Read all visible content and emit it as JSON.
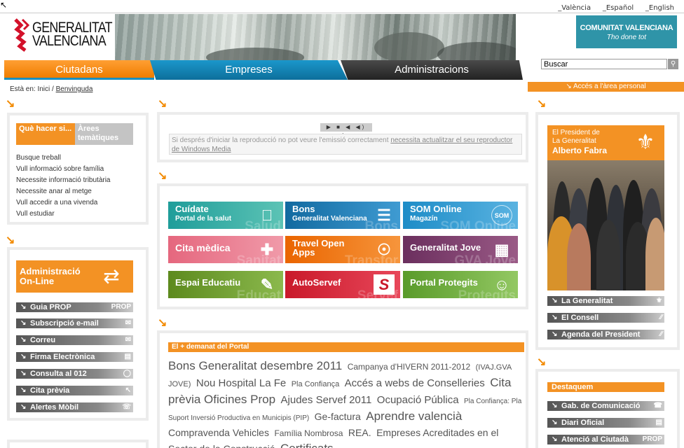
{
  "languages": [
    "_València",
    "_Español",
    "_English"
  ],
  "logo": {
    "line1": "GENERALITAT",
    "line2": "VALENCIANA"
  },
  "brand_badge": {
    "title": "COMUNITAT VALENCIANA",
    "tagline": "Tho done tot"
  },
  "tabs": [
    "Ciutadans",
    "Empreses",
    "Administracions"
  ],
  "search": {
    "value": "Buscar"
  },
  "personal_area": "Accés a l'àrea personal",
  "breadcrumb": {
    "prefix": "Està en: Inici /",
    "current": "Benvinguda"
  },
  "quick_help": {
    "tab_a": "Què hacer si...",
    "tab_b": "Àrees temàtiques",
    "items": [
      "Busque treball",
      "Vull informació sobre família",
      "Necessite informació tributària",
      "Necessite anar al metge",
      "Vull accedir a una vivenda",
      "Vull estudiar"
    ]
  },
  "admin_online": {
    "title": "Administració On-Line",
    "buttons": [
      "Guia PROP",
      "Subscripció e-mail",
      "Correu",
      "Firma Electrònica",
      "Consulta al 012",
      "Cita prèvia",
      "Alertes Mòbil"
    ]
  },
  "player": {
    "controls": "▶ ■ ◀ ◀) ◀) ◀",
    "message": "Si després d'iniciar la reproducció no pot veure l'emissió correctament",
    "link": "necessita actualitzar el seu reproductor de Windows Media"
  },
  "tiles": [
    {
      "title": "Cuídate",
      "sub": "Portal de la salut",
      "ghost": "Salud"
    },
    {
      "title": "Bons",
      "sub": "Generalitat Valenciana",
      "ghost": "Bons"
    },
    {
      "title": "SOM Online",
      "sub": "Magazín",
      "ghost": "SOM Online"
    },
    {
      "title": "Cita mèdica",
      "sub": "",
      "ghost": "Sanitat"
    },
    {
      "title": "Travel Open Apps",
      "sub": "",
      "ghost": "Transfor"
    },
    {
      "title": "Generalitat Jove",
      "sub": "",
      "ghost": "GVA Jove"
    },
    {
      "title": "Espai Educatiu",
      "sub": "",
      "ghost": "Educat"
    },
    {
      "title": "AutoServef",
      "sub": "",
      "ghost": "Servef"
    },
    {
      "title": "Portal Protegits",
      "sub": "",
      "ghost": "Protegits"
    }
  ],
  "cloud": {
    "title": "El + demanat del Portal",
    "terms": [
      {
        "t": "Bons Generalitat desembre 2011",
        "s": 17
      },
      {
        "t": "Campanya d'HIVERN 2011-2012",
        "s": 12
      },
      {
        "t": "(IVAJ.GVA JOVE)",
        "s": 11
      },
      {
        "t": "Nou Hospital La Fe",
        "s": 15
      },
      {
        "t": "Pla Confiança",
        "s": 11
      },
      {
        "t": "Accés a webs de Conselleries",
        "s": 15
      },
      {
        "t": "Cita prèvia Oficines Prop",
        "s": 17
      },
      {
        "t": "Ajudes Servef 2011",
        "s": 15
      },
      {
        "t": "Ocupació Pública",
        "s": 15
      },
      {
        "t": "Pla Confiança: Pla Suport Inversió Productiva en Municipis (PIP)",
        "s": 10
      },
      {
        "t": "Ge-factura",
        "s": 14
      },
      {
        "t": "Aprendre valencià",
        "s": 17
      },
      {
        "t": "Compravenda Vehicles",
        "s": 14
      },
      {
        "t": "Família Nombrosa",
        "s": 12
      },
      {
        "t": "REA.",
        "s": 14
      },
      {
        "t": "Empreses Acreditades en el Sector de la Construcció",
        "s": 14
      },
      {
        "t": "Certificats",
        "s": 17
      }
    ]
  },
  "president": {
    "line1": "El President de",
    "line2": "La Generalitat",
    "name": "Alberto Fabra",
    "buttons": [
      "La Generalitat",
      "El Consell",
      "Agenda del President"
    ]
  },
  "destaquem": {
    "title": "Destaquem",
    "buttons": [
      "Gab. de Comunicació",
      "Diari Oficial",
      "Atenció al Ciutadà"
    ]
  },
  "colors": {
    "accent": "#f39224",
    "blue": "#0d6f9b",
    "dark": "#222222"
  }
}
